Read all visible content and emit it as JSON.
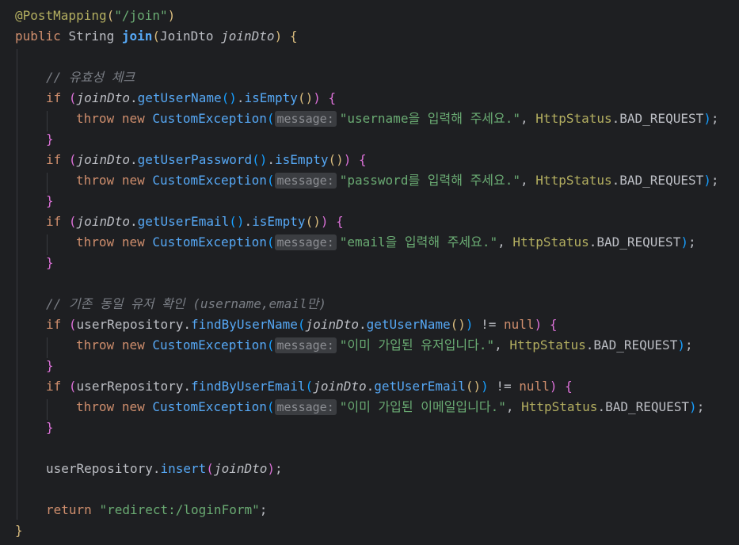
{
  "code": {
    "annotation": "@PostMapping",
    "mapping_path": "\"/join\"",
    "signature": {
      "modifier": "public",
      "return_type": "String",
      "method_name": "join",
      "param_type": "JoinDto",
      "param_name": "joinDto"
    },
    "comment_validation": "// 유효성 체크",
    "comment_duplicate": "// 기존 동일 유저 확인 (username,email만)",
    "hint_label": "message:",
    "exception_class": "CustomException",
    "status_class": "HttpStatus",
    "status_value": "BAD_REQUEST",
    "checks": [
      {
        "getter": "getUserName",
        "message": "\"username을 입력해 주세요.\""
      },
      {
        "getter": "getUserPassword",
        "message": "\"password를 입력해 주세요.\""
      },
      {
        "getter": "getUserEmail",
        "message": "\"email을 입력해 주세요.\""
      }
    ],
    "dup_checks": [
      {
        "finder": "findByUserName",
        "getter": "getUserName",
        "message": "\"이미 가입된 유저입니다.\""
      },
      {
        "finder": "findByUserEmail",
        "getter": "getUserEmail",
        "message": "\"이미 가입된 이메일입니다.\""
      }
    ],
    "repository": "userRepository",
    "insert_method": "insert",
    "return_value": "\"redirect:/loginForm\""
  },
  "colors": {
    "background": "#1e1f22",
    "keyword": "#cf8e6d",
    "string": "#6aab73",
    "method": "#56a8f5",
    "comment": "#7a7e85"
  }
}
